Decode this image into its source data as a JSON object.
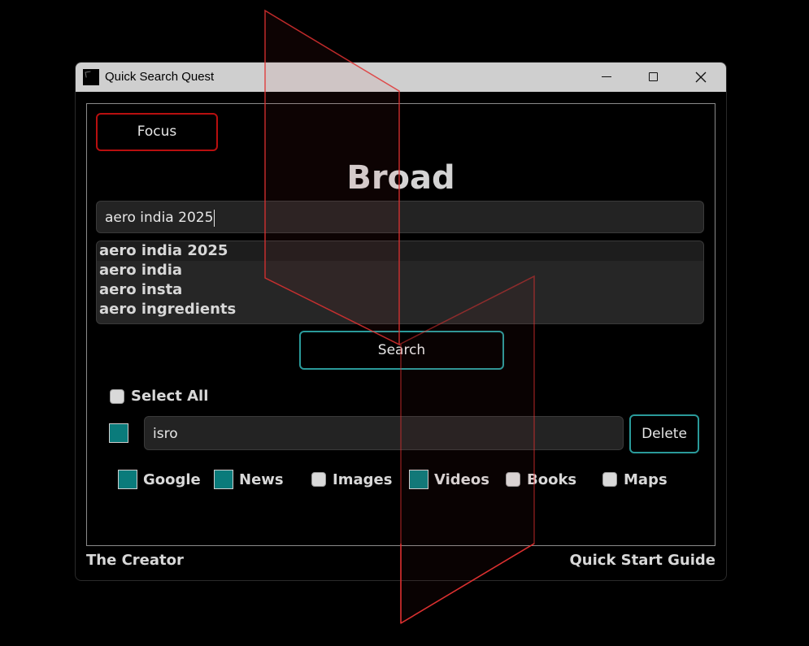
{
  "window": {
    "title": "Quick Search Quest"
  },
  "toolbar": {
    "focus_label": "Focus"
  },
  "mode": {
    "title": "Broad"
  },
  "search": {
    "value": "aero india 2025",
    "button_label": "Search"
  },
  "suggestions": [
    "aero india 2025",
    "aero india",
    "aero insta",
    "aero ingredients"
  ],
  "select_all": {
    "label": "Select All",
    "checked": false
  },
  "saved_items": [
    {
      "value": "isro",
      "checked": true,
      "delete_label": "Delete"
    }
  ],
  "sources": [
    {
      "label": "Google",
      "checked": true
    },
    {
      "label": "News",
      "checked": true
    },
    {
      "label": "Images",
      "checked": false
    },
    {
      "label": "Videos",
      "checked": true
    },
    {
      "label": "Books",
      "checked": false
    },
    {
      "label": "Maps",
      "checked": false
    }
  ],
  "footer": {
    "left_link": "The Creator",
    "right_link": "Quick Start Guide"
  },
  "colors": {
    "accent_teal": "#2a9a9a",
    "checkbox_on": "#0a7b7b",
    "focus_red": "#b80f0f",
    "overlay_red": "#e03131"
  },
  "icons": {
    "minimize": "minimize-icon",
    "maximize": "maximize-icon",
    "close": "close-icon"
  }
}
